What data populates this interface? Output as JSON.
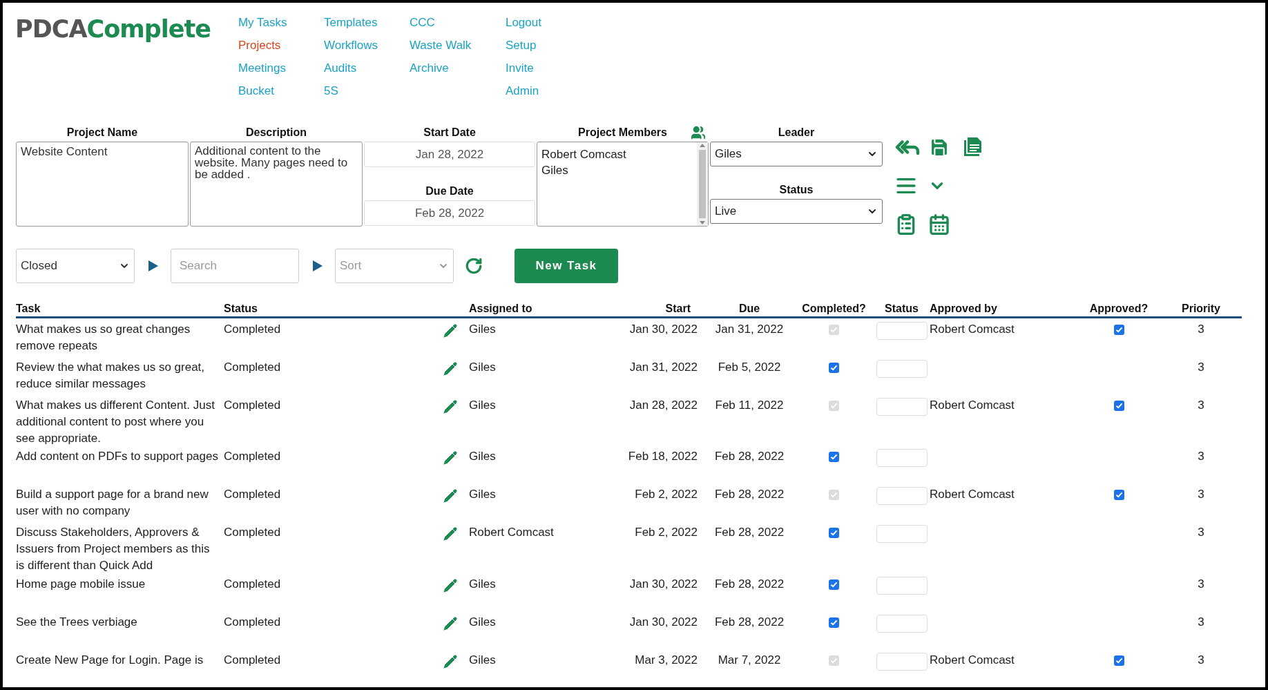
{
  "logo": {
    "part1": "PDCA",
    "part2": "Complete"
  },
  "nav": [
    [
      {
        "label": "My Tasks",
        "selected": false
      },
      {
        "label": "Projects",
        "selected": true
      },
      {
        "label": "Meetings",
        "selected": false
      },
      {
        "label": "Bucket",
        "selected": false
      }
    ],
    [
      {
        "label": "Templates",
        "selected": false
      },
      {
        "label": "Workflows",
        "selected": false
      },
      {
        "label": "Audits",
        "selected": false
      },
      {
        "label": "5S",
        "selected": false
      }
    ],
    [
      {
        "label": "CCC",
        "selected": false
      },
      {
        "label": "Waste Walk",
        "selected": false
      },
      {
        "label": "Archive",
        "selected": false
      }
    ],
    [
      {
        "label": "Logout",
        "selected": false
      },
      {
        "label": "Setup",
        "selected": false
      },
      {
        "label": "Invite",
        "selected": false
      },
      {
        "label": "Admin",
        "selected": false
      }
    ]
  ],
  "project": {
    "name": {
      "label": "Project Name",
      "value": "Website Content"
    },
    "description": {
      "label": "Description",
      "value": "Additional content to the website.  Many pages need to be added ."
    },
    "start_date": {
      "label": "Start Date",
      "value": "Jan 28, 2022"
    },
    "due_date": {
      "label": "Due Date",
      "value": "Feb 28, 2022"
    },
    "members": {
      "label": "Project Members",
      "items": [
        "Robert Comcast",
        "Giles"
      ]
    },
    "leader": {
      "label": "Leader",
      "value": "Giles"
    },
    "status": {
      "label": "Status",
      "value": "Live"
    }
  },
  "toolbar": {
    "filter": "Closed",
    "search_placeholder": "Search",
    "sort_placeholder": "Sort",
    "new_task": "New Task"
  },
  "table": {
    "columns": [
      "Task",
      "Status",
      "Assigned to",
      "Start",
      "Due",
      "Completed?",
      "Status",
      "Approved by",
      "Approved?",
      "Priority"
    ],
    "rows": [
      {
        "task": "What makes us so great changes remove repeats",
        "status": "Completed",
        "assigned": "Giles",
        "start": "Jan 30, 2022",
        "due": "Jan 31, 2022",
        "completed": {
          "checked": true,
          "disabled": true
        },
        "approved_by": "Robert Comcast",
        "approved": true,
        "priority": "3"
      },
      {
        "task": "Review the what makes us so great, reduce similar messages",
        "status": "Completed",
        "assigned": "Giles",
        "start": "Jan 31, 2022",
        "due": "Feb 5, 2022",
        "completed": {
          "checked": true,
          "disabled": false
        },
        "approved": false,
        "priority": "3"
      },
      {
        "task": "What makes us different Content. Just additional content to post where you see appropriate.",
        "status": "Completed",
        "assigned": "Giles",
        "start": "Jan 28, 2022",
        "due": "Feb 11, 2022",
        "completed": {
          "checked": true,
          "disabled": true
        },
        "approved_by": "Robert Comcast",
        "approved": true,
        "priority": "3"
      },
      {
        "task": "Add content on PDFs to support pages",
        "status": "Completed",
        "assigned": "Giles",
        "start": "Feb 18, 2022",
        "due": "Feb 28, 2022",
        "completed": {
          "checked": true,
          "disabled": false
        },
        "approved": false,
        "priority": "3"
      },
      {
        "task": "Build a support page for a brand new user with no company",
        "status": "Completed",
        "assigned": "Giles",
        "start": "Feb 2, 2022",
        "due": "Feb 28, 2022",
        "completed": {
          "checked": true,
          "disabled": true
        },
        "approved_by": "Robert Comcast",
        "approved": true,
        "priority": "3"
      },
      {
        "task": "Discuss Stakeholders, Approvers & Issuers from Project members as this is different than Quick Add",
        "status": "Completed",
        "assigned": "Robert Comcast",
        "start": "Feb 2, 2022",
        "due": "Feb 28, 2022",
        "completed": {
          "checked": true,
          "disabled": false
        },
        "approved": false,
        "priority": "3"
      },
      {
        "task": "Home page mobile issue",
        "status": "Completed",
        "assigned": "Giles",
        "start": "Jan 30, 2022",
        "due": "Feb 28, 2022",
        "completed": {
          "checked": true,
          "disabled": false
        },
        "approved": false,
        "priority": "3"
      },
      {
        "task": "See the Trees verbiage",
        "status": "Completed",
        "assigned": "Giles",
        "start": "Jan 30, 2022",
        "due": "Feb 28, 2022",
        "completed": {
          "checked": true,
          "disabled": false
        },
        "approved": false,
        "priority": "3"
      },
      {
        "task": "Create New Page for Login. Page is",
        "status": "Completed",
        "assigned": "Giles",
        "start": "Mar 3, 2022",
        "due": "Mar 7, 2022",
        "completed": {
          "checked": true,
          "disabled": true
        },
        "approved_by": "Robert Comcast",
        "approved": true,
        "priority": "3"
      }
    ]
  }
}
